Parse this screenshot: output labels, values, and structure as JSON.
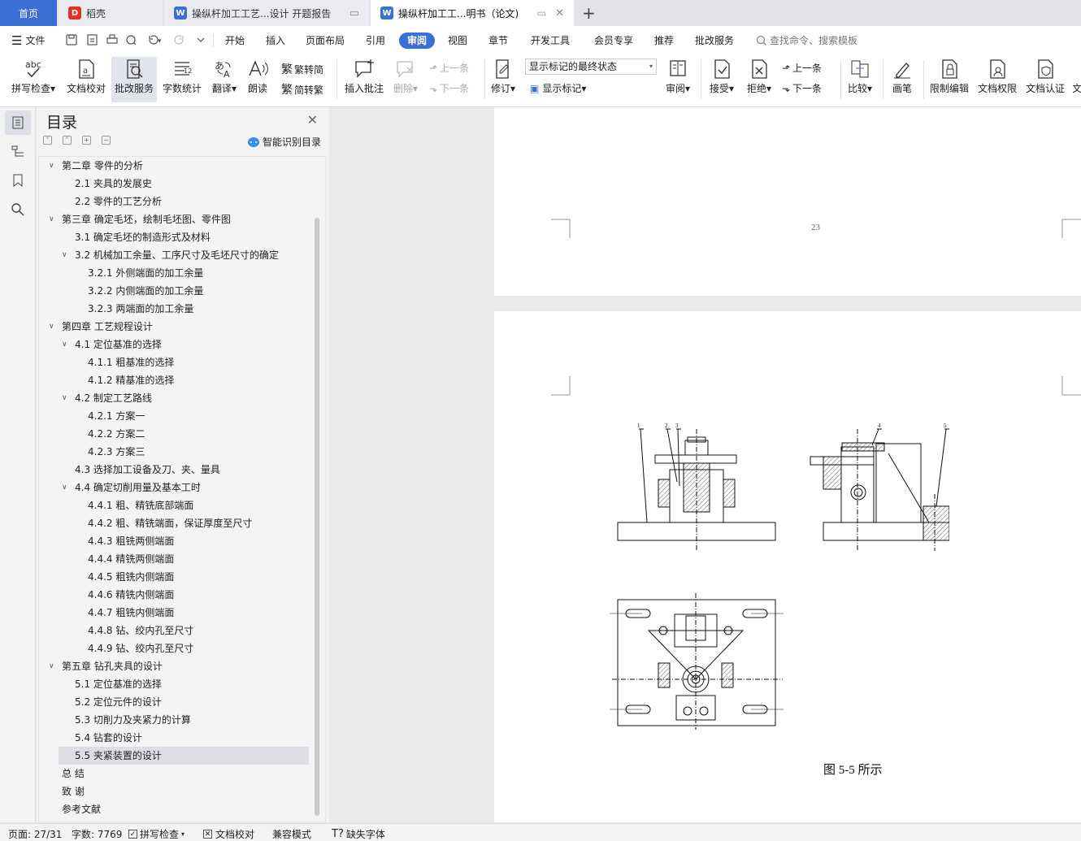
{
  "tabs": {
    "home": "首页",
    "tab1": "稻壳",
    "tab2": "操纵杆加工工艺...设计 开题报告",
    "tab3": "操纵杆加工工...明书（论文)"
  },
  "menu": {
    "file": "文件",
    "items": [
      "开始",
      "插入",
      "页面布局",
      "引用",
      "审阅",
      "视图",
      "章节",
      "开发工具",
      "会员专享",
      "推荐",
      "批改服务"
    ],
    "active": "审阅",
    "search": "查找命令、搜索模板"
  },
  "ribbon": {
    "spell": "拼写检查",
    "proof": "文档校对",
    "correct": "批改服务",
    "wordcount": "字数统计",
    "translate": "翻译",
    "read": "朗读",
    "trad2simp": "繁转简",
    "simp2trad": "简转繁",
    "insert_comment": "插入批注",
    "delete": "删除",
    "prev_comment": "上一条",
    "next_comment": "下一条",
    "revise": "修订",
    "markup_state": "显示标记的最终状态",
    "show_markup": "显示标记",
    "review": "审阅",
    "accept": "接受",
    "reject": "拒绝",
    "prev_change": "上一条",
    "next_change": "下一条",
    "compare": "比较",
    "pen": "画笔",
    "restrict": "限制编辑",
    "permission": "文档权限",
    "certify": "文档认证",
    "more": "文"
  },
  "toc": {
    "title": "目录",
    "smart": "智能识别目录",
    "items": [
      {
        "text": "第二章  零件的分析",
        "level": 1,
        "arrow": true
      },
      {
        "text": "2.1  夹具的发展史",
        "level": 2,
        "arrow": false
      },
      {
        "text": "2.2  零件的工艺分析",
        "level": 2,
        "arrow": false
      },
      {
        "text": "第三章  确定毛坯，绘制毛坯图、零件图",
        "level": 1,
        "arrow": true
      },
      {
        "text": "3.1  确定毛坯的制造形式及材料",
        "level": 2,
        "arrow": false
      },
      {
        "text": "3.2  机械加工余量、工序尺寸及毛坯尺寸的确定",
        "level": 2,
        "arrow": true
      },
      {
        "text": "3.2.1  外侧端面的加工余量",
        "level": 3,
        "arrow": false
      },
      {
        "text": "3.2.2  内侧端面的加工余量",
        "level": 3,
        "arrow": false
      },
      {
        "text": "3.2.3  两端面的加工余量",
        "level": 3,
        "arrow": false
      },
      {
        "text": "第四章  工艺规程设计",
        "level": 1,
        "arrow": true
      },
      {
        "text": "4.1  定位基准的选择",
        "level": 2,
        "arrow": true
      },
      {
        "text": "4.1.1  粗基准的选择",
        "level": 3,
        "arrow": false
      },
      {
        "text": "4.1.2  精基准的选择",
        "level": 3,
        "arrow": false
      },
      {
        "text": "4.2  制定工艺路线",
        "level": 2,
        "arrow": true
      },
      {
        "text": "4.2.1  方案一",
        "level": 3,
        "arrow": false
      },
      {
        "text": "4.2.2  方案二",
        "level": 3,
        "arrow": false
      },
      {
        "text": "4.2.3  方案三",
        "level": 3,
        "arrow": false
      },
      {
        "text": "4.3  选择加工设备及刀、夹、量具",
        "level": 2,
        "arrow": false
      },
      {
        "text": "4.4  确定切削用量及基本工时",
        "level": 2,
        "arrow": true
      },
      {
        "text": "4.4.1  粗、精铣底部端面",
        "level": 3,
        "arrow": false
      },
      {
        "text": "4.4.2  粗、精铣端面，保证厚度至尺寸",
        "level": 3,
        "arrow": false
      },
      {
        "text": "4.4.3  粗铣两侧端面",
        "level": 3,
        "arrow": false
      },
      {
        "text": "4.4.4  精铣两侧端面",
        "level": 3,
        "arrow": false
      },
      {
        "text": "4.4.5  粗铣内侧端面",
        "level": 3,
        "arrow": false
      },
      {
        "text": "4.4.6  精铣内侧端面",
        "level": 3,
        "arrow": false
      },
      {
        "text": "4.4.7  粗铣内侧端面",
        "level": 3,
        "arrow": false
      },
      {
        "text": "4.4.8  钻、绞内孔至尺寸",
        "level": 3,
        "arrow": false
      },
      {
        "text": "4.4.9  钻、绞内孔至尺寸",
        "level": 3,
        "arrow": false
      },
      {
        "text": "第五章  钻孔夹具的设计",
        "level": 1,
        "arrow": true
      },
      {
        "text": "5.1 定位基准的选择",
        "level": 2,
        "arrow": false
      },
      {
        "text": "5.2 定位元件的设计",
        "level": 2,
        "arrow": false
      },
      {
        "text": "5.3 切削力及夹紧力的计算",
        "level": 2,
        "arrow": false
      },
      {
        "text": "5.4 钻套的设计",
        "level": 2,
        "arrow": false
      },
      {
        "text": "5.5 夹紧装置的设计",
        "level": 2,
        "arrow": false,
        "selected": true
      },
      {
        "text": "总    结",
        "level": 1,
        "arrow": false
      },
      {
        "text": "致    谢",
        "level": 1,
        "arrow": false
      },
      {
        "text": "参考文献",
        "level": 1,
        "arrow": false
      }
    ]
  },
  "document": {
    "page_number": "23",
    "drawing_labels": [
      "1",
      "2",
      "3",
      "4",
      "5"
    ],
    "caption": "图 5-5  所示"
  },
  "status": {
    "page": "页面: 27/31",
    "words": "字数: 7769",
    "spell": "拼写检查",
    "proof": "文档校对",
    "compat": "兼容模式",
    "missing_font": "缺失字体"
  },
  "colors": {
    "accent": "#3b6fd3",
    "wps_red": "#e0312c"
  }
}
